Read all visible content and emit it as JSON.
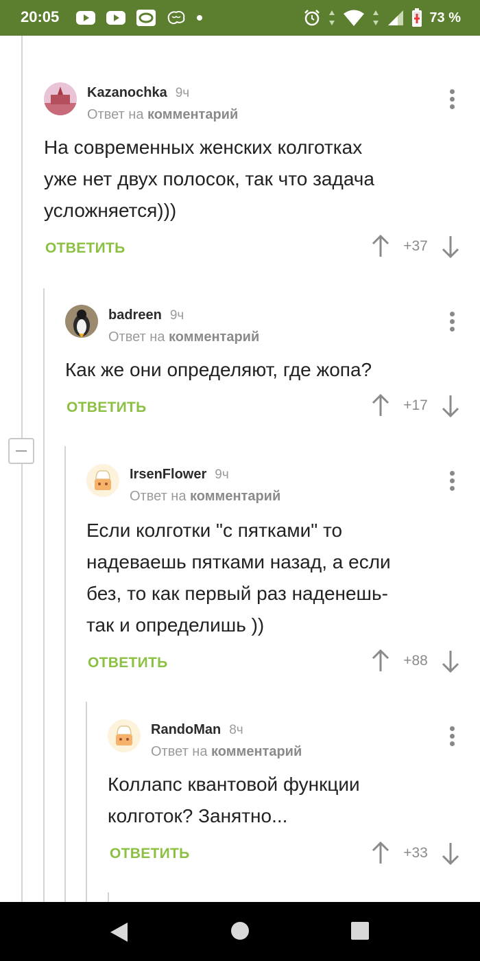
{
  "status_bar": {
    "time": "20:05",
    "battery": "73 %",
    "icons": [
      "youtube-icon",
      "youtube-icon",
      "media-icon",
      "brain-icon",
      "dot-icon",
      "alarm-icon",
      "data-arrows-icon",
      "wifi-icon",
      "signal-icon",
      "battery-icon"
    ]
  },
  "colors": {
    "status_bar": "#5b7e2f",
    "reply_green": "#8cc043"
  },
  "comments": [
    {
      "author": "Kazanochka",
      "time": "9ч",
      "reply_prefix": "Ответ на",
      "reply_link": "комментарий",
      "lines": [
        "На современных женских колготках",
        "уже нет двух полосок, так что задача",
        "усложняется)))"
      ],
      "reply_label": "ОТВЕТИТЬ",
      "votes": "+37"
    },
    {
      "author": "badreen",
      "time": "9ч",
      "reply_prefix": "Ответ на",
      "reply_link": "комментарий",
      "lines": [
        "Как же они определяют, где жопа?"
      ],
      "reply_label": "ОТВЕТИТЬ",
      "votes": "+17"
    },
    {
      "author": "IrsenFlower",
      "time": "9ч",
      "reply_prefix": "Ответ на",
      "reply_link": "комментарий",
      "lines": [
        "Если колготки \"с пятками\" то",
        "надеваешь пятками назад, а если",
        "без, то как первый раз наденешь-",
        "так и определишь ))"
      ],
      "reply_label": "ОТВЕТИТЬ",
      "votes": "+88"
    },
    {
      "author": "RandoMan",
      "time": "8ч",
      "reply_prefix": "Ответ на",
      "reply_link": "комментарий",
      "lines": [
        "Коллапс квантовой функции",
        "колготок? Занятно..."
      ],
      "reply_label": "ОТВЕТИТЬ",
      "votes": "+33"
    }
  ]
}
